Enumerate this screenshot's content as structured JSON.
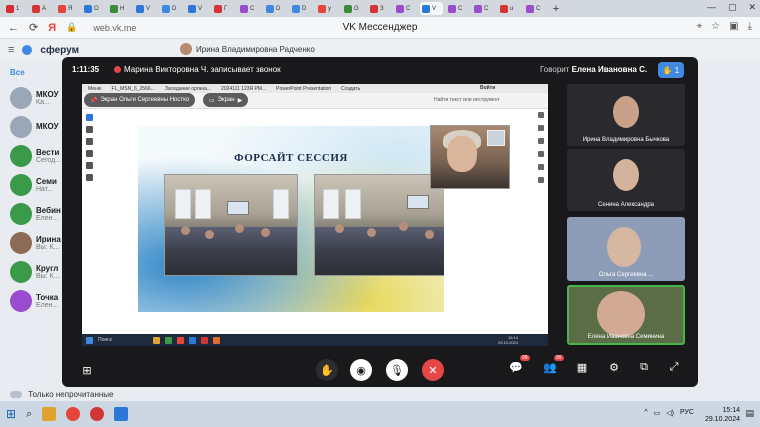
{
  "browser": {
    "tabs": [
      {
        "text": "1",
        "color": "#d62d2d"
      },
      {
        "text": "A",
        "color": "#d13636"
      },
      {
        "text": "Я",
        "color": "#e5453b"
      },
      {
        "text": "O",
        "color": "#2b78d8"
      },
      {
        "text": "H",
        "color": "#3a8a3a"
      },
      {
        "text": "V",
        "color": "#2b78d8"
      },
      {
        "text": "D",
        "color": "#3f8ae0"
      },
      {
        "text": "V",
        "color": "#2b78d8"
      },
      {
        "text": "Г",
        "color": "#d13636"
      },
      {
        "text": "C",
        "color": "#9a4ccf"
      },
      {
        "text": "D",
        "color": "#3f8ae0"
      },
      {
        "text": "D",
        "color": "#3f8ae0"
      },
      {
        "text": "y",
        "color": "#e5453b"
      },
      {
        "text": "G",
        "color": "#3a8a3a"
      },
      {
        "text": "З",
        "color": "#d13636"
      },
      {
        "text": "C",
        "color": "#9a4ccf"
      },
      {
        "text": "V",
        "color": "#2b78d8",
        "active": true
      },
      {
        "text": "C",
        "color": "#9a4ccf"
      },
      {
        "text": "C",
        "color": "#9a4ccf"
      },
      {
        "text": "u",
        "color": "#d13636"
      },
      {
        "text": "C",
        "color": "#9a4ccf"
      }
    ],
    "url": "web.vk.me",
    "page_title": "VK Мессенджер"
  },
  "vk": {
    "brand": "сферум",
    "chat_name": "Ирина Владимировна Радченко",
    "sidebar": [
      {
        "title": "Все",
        "sub": "",
        "color": "#e8ebef",
        "tab": true
      },
      {
        "title": "МКОУ",
        "sub": "Ка...",
        "color": "#9aa7b8"
      },
      {
        "title": "МКОУ",
        "sub": "",
        "color": "#9aa7b8"
      },
      {
        "title": "Вести",
        "sub": "Сегод...",
        "color": "#3a9a4a"
      },
      {
        "title": "Семи",
        "sub": "Нат...",
        "color": "#3a9a4a"
      },
      {
        "title": "Вебин",
        "sub": "Елен...",
        "color": "#3a9a4a"
      },
      {
        "title": "Ирина",
        "sub": "Вы: К...",
        "color": "#8c6a56"
      },
      {
        "title": "Кругл",
        "sub": "Вы: К...",
        "color": "#3a9a4a"
      },
      {
        "title": "Точка",
        "sub": "Елен...",
        "color": "#9a4ccf"
      }
    ],
    "unread_label": "Только непрочитанные"
  },
  "call": {
    "duration": "1:11:35",
    "recording_text": "Марина Викторовна Ч. записывает звонок",
    "speaking_prefix": "Говорит",
    "speaking_name": "Елена Ивановна С.",
    "participants": "1",
    "share": {
      "pdf_tabs": [
        "Меню",
        "FL_MSN_6_2566...",
        "Заседание органа...",
        "2024111 123Я РМ...",
        "PowerPoint Presentation",
        "Создать"
      ],
      "pdf_login": "Войти",
      "pdf_search": "Найти текст или инструмент",
      "slide_title": "ФОРСАЙТ СЕССИЯ",
      "taskbar_search": "Поиск",
      "taskbar_time": "15:14",
      "taskbar_date": "29.10.2024"
    },
    "pills": {
      "presenter": "Экран Ольги Сергеевны Ностко",
      "screen": "Экран"
    },
    "tiles": [
      {
        "name": "Ирина Владимировна Бычкова",
        "bg": "#2a2a2e",
        "face": "#c9a189"
      },
      {
        "name": "Сенина Александра",
        "bg": "#2a2a2e",
        "face": "#d3b39b"
      },
      {
        "name": "Ольга Сергеевна ...",
        "bg": "#8d9db8",
        "face": "#d6b8a2"
      },
      {
        "name": "Елена Ивановна Семинина",
        "bg": "#5b6d47",
        "face": "#d2a993"
      }
    ],
    "controls": {
      "chat_badge": "99",
      "people_badge": "99"
    }
  },
  "taskbar": {
    "lang": "РУС",
    "time": "15:14",
    "date": "29.10.2024"
  }
}
